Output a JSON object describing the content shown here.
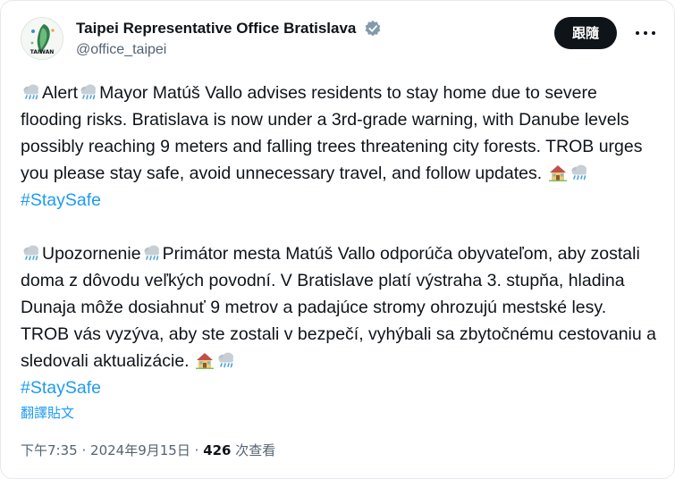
{
  "account": {
    "display_name": "Taipei Representative Office Bratislava",
    "handle": "@office_taipei",
    "avatar_label": "TAIWAN",
    "verified_icon": "verified-badge-icon"
  },
  "actions": {
    "follow_label": "跟隨",
    "more_icon": "more-options-icon"
  },
  "post": {
    "para1": {
      "alert": "Alert",
      "text": "Mayor Matúš Vallo advises residents to stay home due to severe flooding risks. Bratislava is now under a 3rd-grade warning, with Danube levels possibly reaching 9 meters and falling trees threatening city forests. TROB urges you please stay safe, avoid unnecessary travel, and follow updates.",
      "hashtag": "#StaySafe"
    },
    "para2": {
      "alert": "Upozornenie",
      "text": "Primátor mesta Matúš Vallo odporúča obyvateľom, aby zostali doma z dôvodu veľkých povodní. V Bratislave platí výstraha 3. stupňa, hladina Dunaja môže dosiahnuť 9 metrov a padajúce stromy ohrozujú mestské lesy. TROB vás vyzýva, aby ste zostali v bezpečí, vyhýbali sa zbytočnému cestovaniu a sledovali aktualizácie.",
      "hashtag": "#StaySafe"
    },
    "emoji_icons": [
      "rain-cloud-icon",
      "house-icon"
    ],
    "translate_label": "翻譯貼文"
  },
  "meta": {
    "time": "下午7:35",
    "separator": "·",
    "date": "2024年9月15日",
    "views_count": "426",
    "views_label": "次查看"
  }
}
